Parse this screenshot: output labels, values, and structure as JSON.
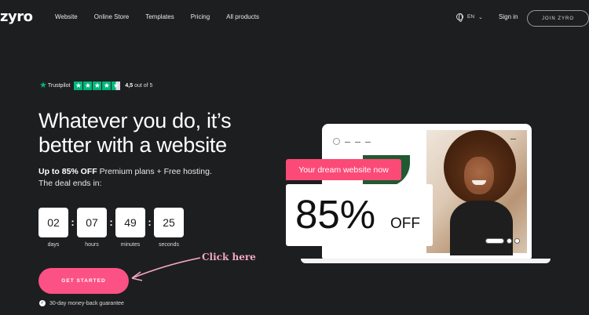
{
  "nav": {
    "logo": "zyro",
    "links": [
      "Website",
      "Online Store",
      "Templates",
      "Pricing",
      "All products"
    ],
    "language": "EN",
    "sign_in": "Sign in",
    "join": "JOIN ZYRO"
  },
  "trustpilot": {
    "name": "Trustpilot",
    "rating_value": "4,5",
    "rating_suffix": "out of 5",
    "stars": 4.5
  },
  "hero": {
    "headline": "Whatever you do, it’s better with a website",
    "offer_bold": "Up to 85% OFF",
    "offer_rest": "Premium plans + Free hosting.",
    "deal_line": "The deal ends in:"
  },
  "countdown": [
    {
      "value": "02",
      "label": "days"
    },
    {
      "value": "07",
      "label": "hours"
    },
    {
      "value": "49",
      "label": "minutes"
    },
    {
      "value": "25",
      "label": "seconds"
    }
  ],
  "cta": {
    "label": "GET STARTED",
    "guarantee": "30-day money-back guarantee"
  },
  "annotation": {
    "text": "Click here"
  },
  "promo": {
    "banner": "Your dream website now",
    "percent": "85%",
    "off": "OFF"
  },
  "colors": {
    "background": "#1d1e20",
    "accent": "#fc5185",
    "trustpilot": "#00b67a"
  }
}
